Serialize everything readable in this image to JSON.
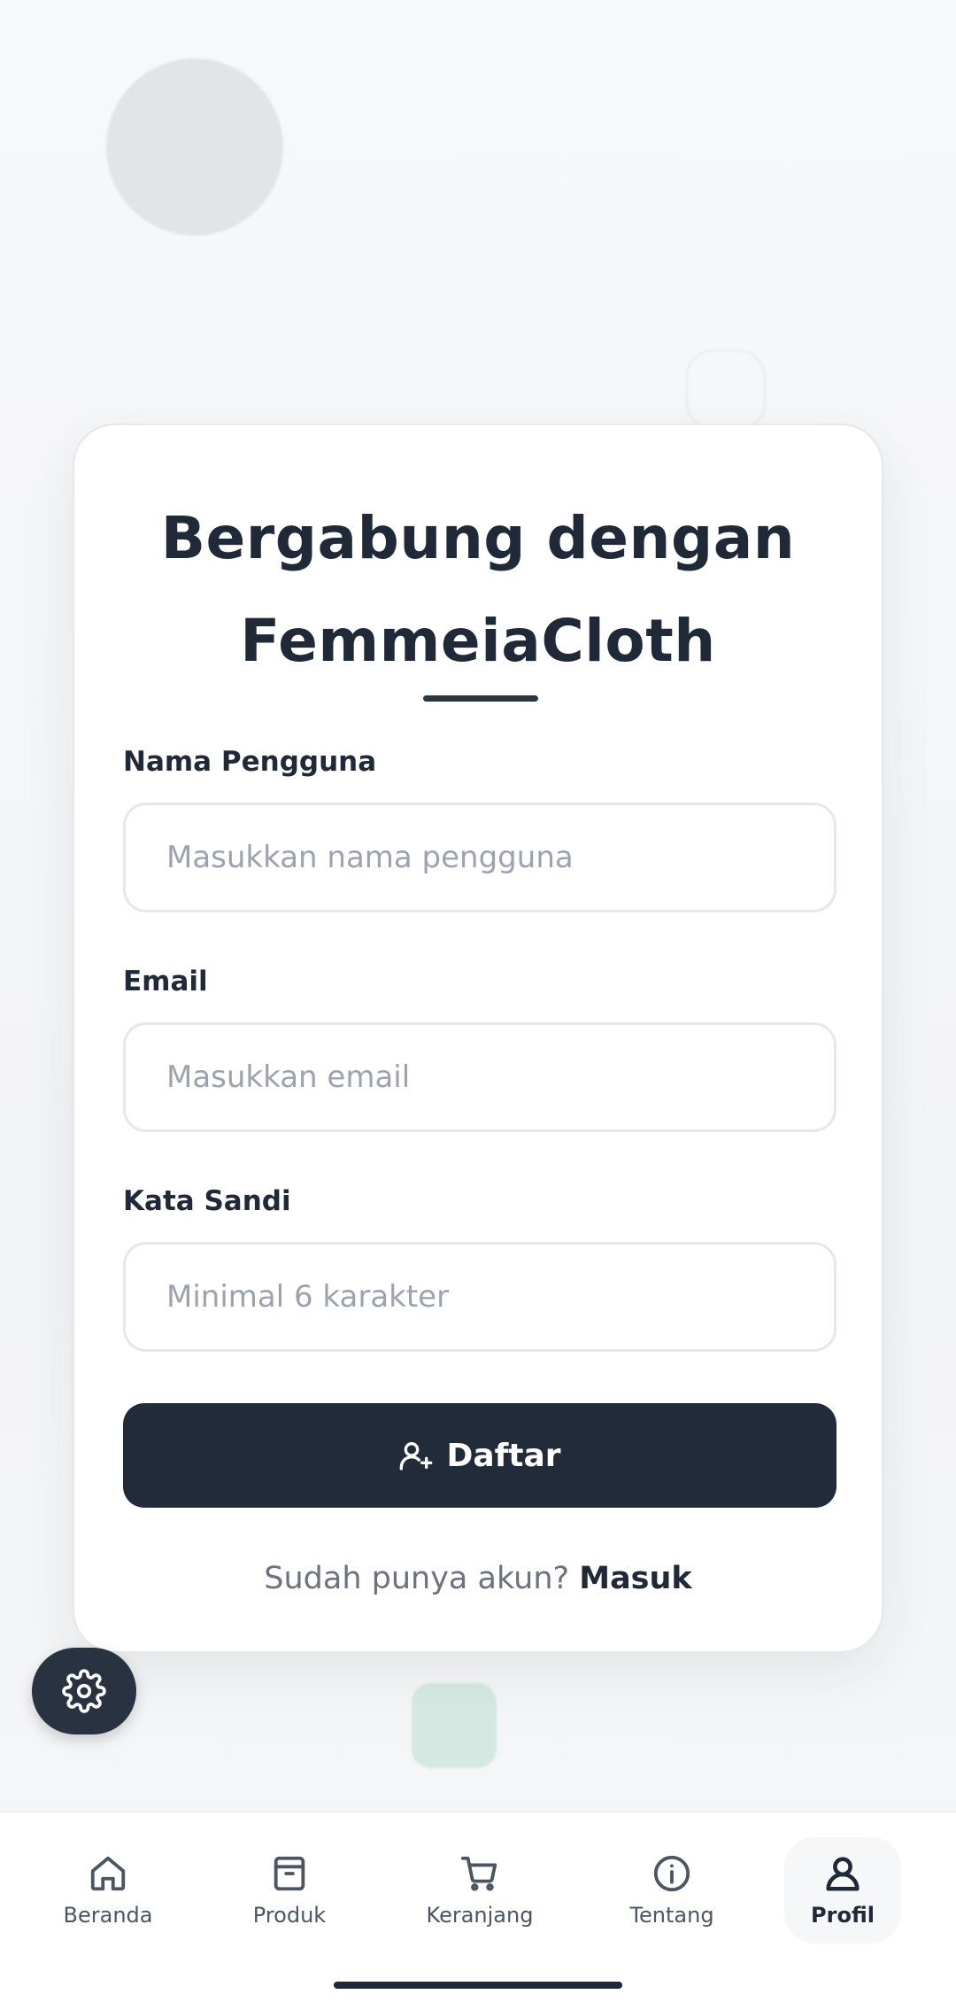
{
  "form": {
    "title_line1": "Bergabung dengan",
    "title_line2": "FemmeiaCloth",
    "username_label": "Nama Pengguna",
    "username_placeholder": "Masukkan nama pengguna",
    "email_label": "Email",
    "email_placeholder": "Masukkan email",
    "password_label": "Kata Sandi",
    "password_placeholder": "Minimal 6 karakter",
    "submit_label": "Daftar",
    "login_prompt": "Sudah punya akun?",
    "login_link": "Masuk"
  },
  "fab": {
    "icon": "gear-icon"
  },
  "nav": {
    "items": [
      {
        "label": "Beranda",
        "icon": "home-icon"
      },
      {
        "label": "Produk",
        "icon": "archive-icon"
      },
      {
        "label": "Keranjang",
        "icon": "cart-icon"
      },
      {
        "label": "Tentang",
        "icon": "info-icon"
      },
      {
        "label": "Profil",
        "icon": "user-icon",
        "active": true
      }
    ]
  },
  "colors": {
    "primary": "#222b39",
    "text": "#1f2937",
    "muted": "#6b7280",
    "placeholder": "#9ca3af",
    "border": "#e5e7eb"
  }
}
